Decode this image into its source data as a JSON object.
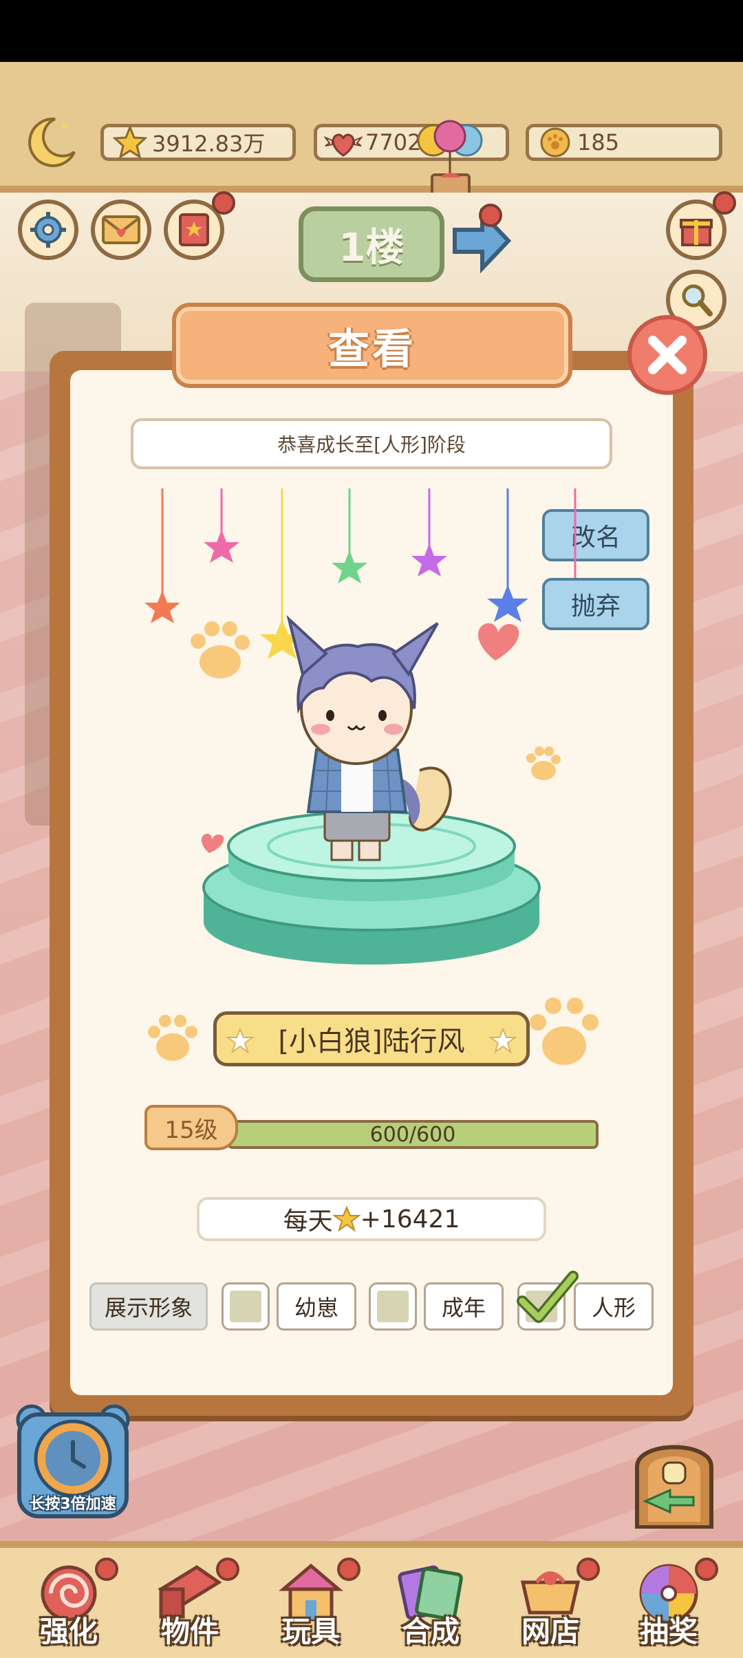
{
  "resources": {
    "stars": "3912.83万",
    "hearts": "7702",
    "coins": "185"
  },
  "floor_sign": "1楼",
  "dialog": {
    "title": "查看",
    "congrats_text": "恭喜成长至[人形]阶段",
    "rename_label": "改名",
    "abandon_label": "抛弃",
    "pet_name": "[小白狼]陆行风",
    "level_label": "15级",
    "xp_text": "600/600",
    "xp_fraction": 1.0,
    "daily_prefix": "每天",
    "daily_value": "+16421",
    "display_label": "展示形象",
    "options": [
      {
        "label": "幼崽",
        "checked": false
      },
      {
        "label": "成年",
        "checked": false
      },
      {
        "label": "人形",
        "checked": true
      }
    ]
  },
  "speedup_label": "长按3倍加速",
  "bottom_nav": [
    {
      "label": "强化",
      "icon": "candy-icon",
      "badge": true
    },
    {
      "label": "物件",
      "icon": "piano-icon",
      "badge": true
    },
    {
      "label": "玩具",
      "icon": "toy-house-icon",
      "badge": true
    },
    {
      "label": "合成",
      "icon": "cards-icon",
      "badge": false
    },
    {
      "label": "网店",
      "icon": "shop-cart-icon",
      "badge": true
    },
    {
      "label": "抽奖",
      "icon": "lottery-wheel-icon",
      "badge": true
    }
  ],
  "colors": {
    "dialog_frame": "#b8763f",
    "dialog_bg": "#fdf6ea",
    "button_blue": "#a9d4ec",
    "xp_fill": "#b6cf78",
    "name_plate": "#f9de8a",
    "close_red": "#f07d6b"
  }
}
